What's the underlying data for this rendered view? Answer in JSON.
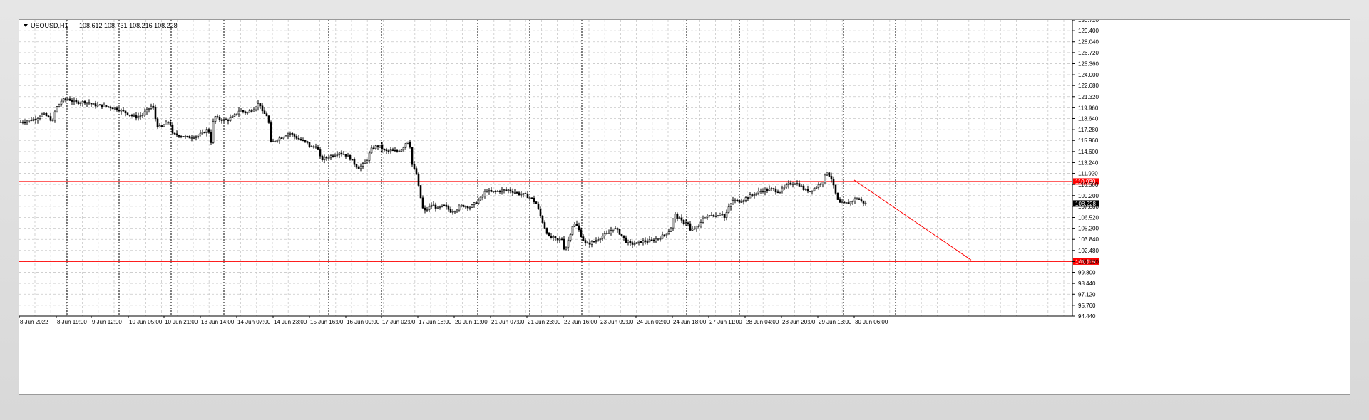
{
  "header": {
    "symbol": "USOUSD,H1",
    "ohlc": "108.612 108.731 108.216 108.228"
  },
  "colors": {
    "background": "#ffffff",
    "grid": "#c8c8c8",
    "candle": "#000000",
    "level_line": "#ff0000",
    "trend_line": "#ff0000",
    "price_label_bg": "#000000"
  },
  "chart_data": {
    "type": "candlestick",
    "title": "USOUSD,H1",
    "ylim": [
      94.44,
      130.72
    ],
    "y_ticks": [
      "130.720",
      "129.400",
      "128.040",
      "126.720",
      "125.360",
      "124.000",
      "122.680",
      "121.320",
      "119.960",
      "118.640",
      "117.280",
      "115.960",
      "114.600",
      "113.240",
      "111.920",
      "110.560",
      "109.200",
      "107.880",
      "106.520",
      "105.200",
      "103.840",
      "102.480",
      "101.120",
      "99.800",
      "98.440",
      "97.120",
      "95.760",
      "94.440"
    ],
    "x_ticks": [
      "8 Jun 2022",
      "8 Jun 19:00",
      "9 Jun 12:00",
      "10 Jun 05:00",
      "10 Jun 21:00",
      "13 Jun 14:00",
      "14 Jun 07:00",
      "14 Jun 23:00",
      "15 Jun 16:00",
      "16 Jun 09:00",
      "17 Jun 02:00",
      "17 Jun 18:00",
      "20 Jun 11:00",
      "21 Jun 07:00",
      "21 Jun 23:00",
      "22 Jun 16:00",
      "23 Jun 09:00",
      "24 Jun 02:00",
      "24 Jun 18:00",
      "27 Jun 11:00",
      "28 Jun 04:00",
      "28 Jun 20:00",
      "29 Jun 13:00",
      "30 Jun 06:00"
    ],
    "grid": true,
    "horizontal_levels": [
      {
        "value": 110.93,
        "label": "110.930"
      },
      {
        "value": 101.119,
        "label": "101.119"
      }
    ],
    "current_price": {
      "value": 108.228,
      "label": "108.228"
    },
    "trend_line": {
      "from": [
        1171,
        111.1
      ],
      "to": [
        1335,
        101.3
      ]
    },
    "close_path": [
      [
        0,
        118.2
      ],
      [
        12,
        118.4
      ],
      [
        22,
        118.6
      ],
      [
        32,
        119.2
      ],
      [
        40,
        118.8
      ],
      [
        46,
        118.3
      ],
      [
        50,
        119.8
      ],
      [
        58,
        120.8
      ],
      [
        66,
        121.1
      ],
      [
        78,
        120.6
      ],
      [
        92,
        120.7
      ],
      [
        104,
        120.3
      ],
      [
        116,
        120.2
      ],
      [
        128,
        120.0
      ],
      [
        140,
        119.7
      ],
      [
        152,
        119.2
      ],
      [
        162,
        118.8
      ],
      [
        172,
        119.1
      ],
      [
        180,
        119.8
      ],
      [
        186,
        120.3
      ],
      [
        192,
        117.8
      ],
      [
        198,
        117.5
      ],
      [
        204,
        118.0
      ],
      [
        210,
        118.4
      ],
      [
        214,
        116.7
      ],
      [
        224,
        116.6
      ],
      [
        236,
        116.3
      ],
      [
        246,
        116.5
      ],
      [
        256,
        116.8
      ],
      [
        264,
        117.4
      ],
      [
        268,
        115.8
      ],
      [
        272,
        119.0
      ],
      [
        278,
        118.6
      ],
      [
        290,
        118.4
      ],
      [
        300,
        118.9
      ],
      [
        308,
        119.7
      ],
      [
        318,
        119.3
      ],
      [
        328,
        119.9
      ],
      [
        336,
        120.6
      ],
      [
        340,
        119.4
      ],
      [
        348,
        118.9
      ],
      [
        352,
        115.6
      ],
      [
        360,
        116.1
      ],
      [
        370,
        116.5
      ],
      [
        378,
        116.9
      ],
      [
        388,
        116.3
      ],
      [
        396,
        115.9
      ],
      [
        402,
        115.7
      ],
      [
        408,
        115.1
      ],
      [
        416,
        115.3
      ],
      [
        422,
        113.6
      ],
      [
        432,
        113.9
      ],
      [
        440,
        114.2
      ],
      [
        448,
        114.5
      ],
      [
        456,
        114.2
      ],
      [
        462,
        113.9
      ],
      [
        468,
        113.2
      ],
      [
        474,
        112.6
      ],
      [
        480,
        112.9
      ],
      [
        486,
        113.4
      ],
      [
        492,
        114.8
      ],
      [
        498,
        115.2
      ],
      [
        504,
        115.3
      ],
      [
        512,
        114.6
      ],
      [
        520,
        114.7
      ],
      [
        528,
        114.6
      ],
      [
        536,
        114.9
      ],
      [
        542,
        115.8
      ],
      [
        546,
        116.0
      ],
      [
        550,
        113.0
      ],
      [
        556,
        111.8
      ],
      [
        560,
        109.8
      ],
      [
        566,
        107.2
      ],
      [
        572,
        107.6
      ],
      [
        578,
        108.1
      ],
      [
        586,
        107.6
      ],
      [
        594,
        108.0
      ],
      [
        604,
        107.3
      ],
      [
        612,
        107.5
      ],
      [
        620,
        108.0
      ],
      [
        626,
        107.9
      ],
      [
        632,
        107.8
      ],
      [
        640,
        108.4
      ],
      [
        648,
        109.0
      ],
      [
        654,
        109.9
      ],
      [
        660,
        109.6
      ],
      [
        668,
        109.7
      ],
      [
        676,
        109.8
      ],
      [
        684,
        109.9
      ],
      [
        692,
        109.7
      ],
      [
        700,
        109.4
      ],
      [
        708,
        109.3
      ],
      [
        714,
        109.0
      ],
      [
        718,
        108.8
      ],
      [
        724,
        108.2
      ],
      [
        730,
        106.7
      ],
      [
        736,
        105.3
      ],
      [
        742,
        104.1
      ],
      [
        748,
        104.0
      ],
      [
        754,
        103.7
      ],
      [
        760,
        103.9
      ],
      [
        764,
        102.4
      ],
      [
        770,
        104.0
      ],
      [
        776,
        105.8
      ],
      [
        782,
        105.4
      ],
      [
        788,
        104.1
      ],
      [
        794,
        103.2
      ],
      [
        800,
        103.4
      ],
      [
        806,
        103.6
      ],
      [
        812,
        104.0
      ],
      [
        818,
        104.3
      ],
      [
        826,
        104.6
      ],
      [
        832,
        105.3
      ],
      [
        838,
        104.9
      ],
      [
        844,
        104.3
      ],
      [
        850,
        103.6
      ],
      [
        856,
        103.3
      ],
      [
        864,
        103.3
      ],
      [
        872,
        103.6
      ],
      [
        880,
        103.6
      ],
      [
        888,
        103.7
      ],
      [
        896,
        104.0
      ],
      [
        904,
        104.4
      ],
      [
        912,
        105.0
      ],
      [
        918,
        106.9
      ],
      [
        924,
        106.4
      ],
      [
        930,
        105.9
      ],
      [
        936,
        106.0
      ],
      [
        940,
        104.9
      ],
      [
        946,
        105.2
      ],
      [
        952,
        105.4
      ],
      [
        958,
        106.5
      ],
      [
        964,
        106.6
      ],
      [
        970,
        106.9
      ],
      [
        976,
        106.7
      ],
      [
        984,
        107.2
      ],
      [
        988,
        106.5
      ],
      [
        994,
        107.7
      ],
      [
        1000,
        108.6
      ],
      [
        1010,
        108.5
      ],
      [
        1020,
        109.0
      ],
      [
        1030,
        109.4
      ],
      [
        1040,
        109.8
      ],
      [
        1048,
        109.9
      ],
      [
        1056,
        110.0
      ],
      [
        1062,
        109.7
      ],
      [
        1070,
        110.0
      ],
      [
        1078,
        110.6
      ],
      [
        1086,
        110.8
      ],
      [
        1094,
        110.5
      ],
      [
        1100,
        109.9
      ],
      [
        1108,
        109.8
      ],
      [
        1114,
        110.1
      ],
      [
        1120,
        110.5
      ],
      [
        1126,
        111.0
      ],
      [
        1132,
        112.1
      ],
      [
        1138,
        111.3
      ],
      [
        1142,
        110.0
      ],
      [
        1148,
        108.3
      ],
      [
        1156,
        108.2
      ],
      [
        1162,
        108.3
      ],
      [
        1168,
        108.6
      ],
      [
        1174,
        108.9
      ],
      [
        1180,
        108.5
      ],
      [
        1186,
        108.228
      ]
    ]
  }
}
